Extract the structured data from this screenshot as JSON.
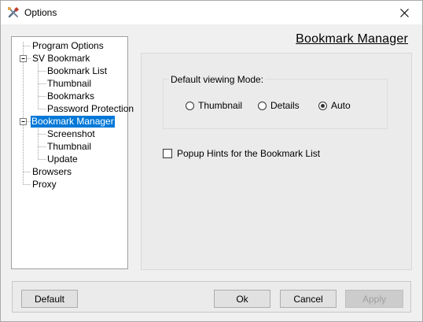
{
  "window": {
    "title": "Options",
    "close_icon": "close-icon",
    "app_icon": "tools-icon"
  },
  "tree": {
    "items": [
      {
        "label": "Program Options"
      },
      {
        "label": "SV Bookmark"
      },
      {
        "label": "Bookmark List"
      },
      {
        "label": "Thumbnail"
      },
      {
        "label": "Bookmarks"
      },
      {
        "label": "Password Protection"
      },
      {
        "label": "Bookmark Manager"
      },
      {
        "label": "Screenshot"
      },
      {
        "label": "Thumbnail"
      },
      {
        "label": "Update"
      },
      {
        "label": "Browsers"
      },
      {
        "label": "Proxy"
      }
    ],
    "selected": "Bookmark Manager",
    "selection_color": "#0078d7"
  },
  "panel": {
    "title": "Bookmark Manager",
    "viewing_mode": {
      "label": "Default viewing Mode:",
      "options": [
        "Thumbnail",
        "Details",
        "Auto"
      ],
      "selected": "Auto"
    },
    "popup_hints": {
      "label": "Popup Hints for the Bookmark List",
      "checked": false
    }
  },
  "buttons": {
    "default": "Default",
    "ok": "Ok",
    "cancel": "Cancel",
    "apply": "Apply"
  }
}
